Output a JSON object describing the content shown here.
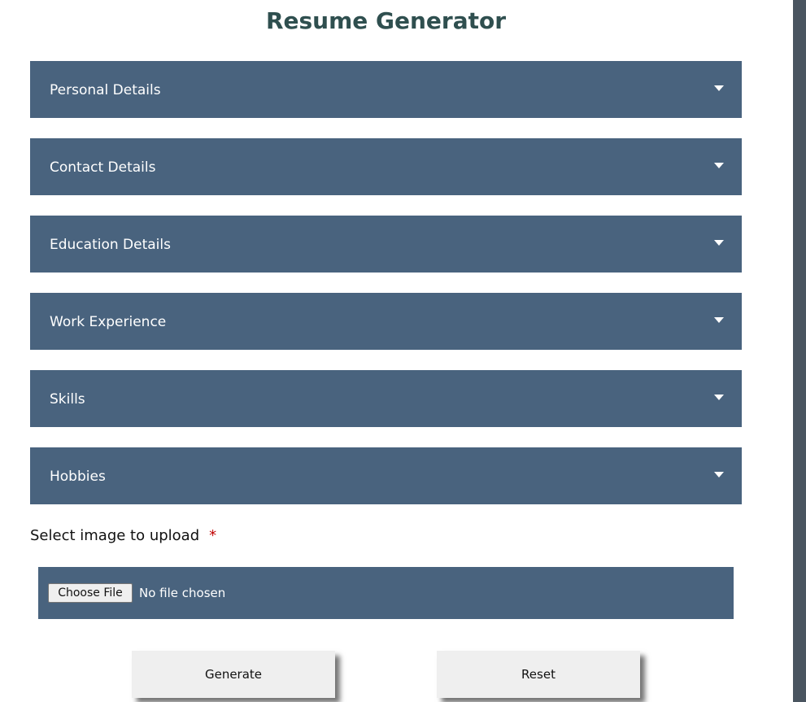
{
  "header": {
    "title": "Resume Generator"
  },
  "sections": [
    {
      "label": "Personal Details"
    },
    {
      "label": "Contact Details"
    },
    {
      "label": "Education Details"
    },
    {
      "label": "Work Experience"
    },
    {
      "label": "Skills"
    },
    {
      "label": "Hobbies"
    }
  ],
  "upload": {
    "label": "Select image to upload",
    "required_mark": "*",
    "choose_button": "Choose File",
    "status": "No file chosen"
  },
  "actions": {
    "generate": "Generate",
    "reset": "Reset"
  },
  "colors": {
    "section_bg": "#49637e",
    "title": "#2f4f4f",
    "required": "#c00000",
    "button_bg": "#efefef"
  },
  "icons": {
    "section_toggle": "caret-down-icon"
  }
}
